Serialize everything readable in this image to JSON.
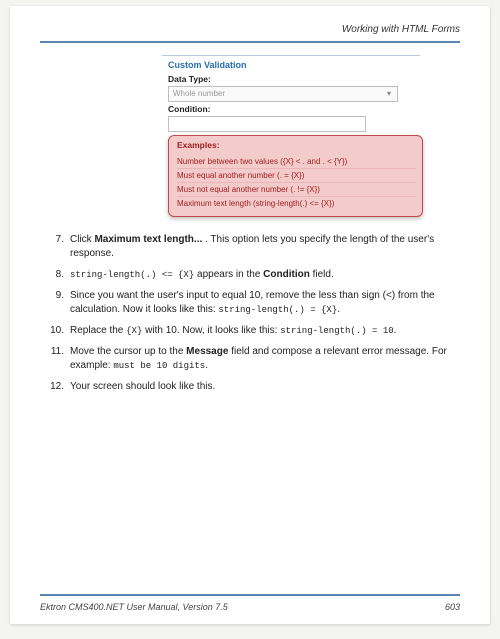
{
  "header": {
    "title": "Working with HTML Forms"
  },
  "figure": {
    "title": "Custom Validation",
    "dataTypeLabel": "Data Type:",
    "dataTypeValue": "Whole number",
    "conditionLabel": "Condition:",
    "tooltip": {
      "title": "Examples:",
      "rows": [
        "Number between two values ({X} < .  and  . < {Y})",
        "Must equal another number (. = {X})",
        "Must not equal another number (. != {X})",
        "Maximum text length (string-length(.) <= {X})"
      ]
    }
  },
  "steps": [
    {
      "num": "7.",
      "parts": [
        {
          "t": "Click "
        },
        {
          "t": "Maximum text length...",
          "bold": true
        },
        {
          "t": " . This option lets you specify the length of the user's response."
        }
      ]
    },
    {
      "num": "8.",
      "parts": [
        {
          "t": "string-length(.) <= {X}",
          "mono": true
        },
        {
          "t": " appears in the "
        },
        {
          "t": "Condition",
          "bold": true
        },
        {
          "t": " field."
        }
      ]
    },
    {
      "num": "9.",
      "parts": [
        {
          "t": "Since you want the user's input to equal 10, remove the less than sign (<) from the calculation. Now it looks like this: "
        },
        {
          "t": "string-length(.) = {X}",
          "mono": true
        },
        {
          "t": "."
        }
      ]
    },
    {
      "num": "10.",
      "parts": [
        {
          "t": "Replace the "
        },
        {
          "t": "{X}",
          "mono": true
        },
        {
          "t": " with 10. Now, it looks like this: "
        },
        {
          "t": "string-length(.) = 10",
          "mono": true
        },
        {
          "t": "."
        }
      ]
    },
    {
      "num": "11.",
      "parts": [
        {
          "t": "Move the cursor up to the "
        },
        {
          "t": "Message",
          "bold": true
        },
        {
          "t": " field and compose a relevant error message. For example: "
        },
        {
          "t": "must be 10 digits",
          "mono": true
        },
        {
          "t": "."
        }
      ]
    },
    {
      "num": "12.",
      "parts": [
        {
          "t": "Your screen should look like this."
        }
      ]
    }
  ],
  "footer": {
    "left": "Ektron CMS400.NET User Manual, Version 7.5",
    "right": "603"
  }
}
